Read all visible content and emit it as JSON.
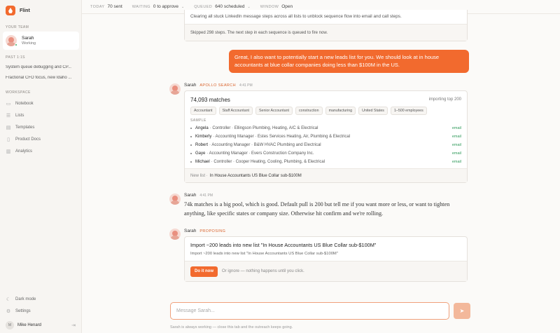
{
  "app": {
    "name": "Flint",
    "accent": "#f26a2e"
  },
  "sidebar": {
    "team_label": "YOUR TEAM",
    "team_member": {
      "name": "Sarah",
      "status": "Working"
    },
    "past_label": "PAST 1:1S",
    "past_items": [
      "System queue debugging and CP...",
      "Fractional CFO focus, new Idaho ..."
    ],
    "workspace_label": "WORKSPACE",
    "workspace_items": [
      {
        "label": "Notebook",
        "icon": "notebook-icon"
      },
      {
        "label": "Lists",
        "icon": "list-icon"
      },
      {
        "label": "Templates",
        "icon": "templates-icon"
      },
      {
        "label": "Product Docs",
        "icon": "document-icon"
      },
      {
        "label": "Analytics",
        "icon": "analytics-icon"
      }
    ],
    "bottom_items": [
      {
        "label": "Dark mode",
        "icon": "moon-icon"
      },
      {
        "label": "Settings",
        "icon": "gear-icon"
      }
    ],
    "user": {
      "initial": "M",
      "name": "Mike Henard"
    }
  },
  "topbar": {
    "today": {
      "label": "TODAY",
      "value": "70 sent"
    },
    "waiting": {
      "label": "WAITING",
      "value": "0 to approve"
    },
    "queued": {
      "label": "QUEUED",
      "value": "640 scheduled"
    },
    "window": {
      "label": "WINDOW",
      "value": "Open"
    }
  },
  "chat": {
    "top_card": {
      "text": "Clearing all stuck LinkedIn message steps across all lists to unblock sequence flow into email and call steps.",
      "footer": "Skipped 298 steps. The next step in each sequence is queued to fire now."
    },
    "user_message": "Great, I also want to potentially start a new leads list for you. We should look at in house accountants at blue collar companies doing less than $100M in the US.",
    "apollo": {
      "sender": "Sarah",
      "tag": "APOLLO SEARCH",
      "time": "4:41 PM",
      "matches": "74,093 matches",
      "importing": "importing top 200",
      "chips": [
        "Accountant",
        "Staff Accountant",
        "Senior Accountant",
        "construction",
        "manufacturing",
        "United States",
        "1–500 employees"
      ],
      "sample_label": "SAMPLE",
      "samples": [
        {
          "name": "Angela",
          "detail": "· Controller · Ellingson Plumbing, Heating, A/C & Electrical",
          "channel": "email"
        },
        {
          "name": "Kimberly",
          "detail": "· Accounting Manager · Estes Services Heating, Air, Plumbing & Electrical",
          "channel": "email"
        },
        {
          "name": "Robert",
          "detail": "· Accounting Manager · B&W HVAC Plumbing and Electrical",
          "channel": "email"
        },
        {
          "name": "Gaye",
          "detail": "· Accounting Manager · Evers Construction Company Inc.",
          "channel": "email"
        },
        {
          "name": "Michael",
          "detail": "· Controller · Cooper Heating, Cooling, Plumbing, & Electrical",
          "channel": "email"
        }
      ],
      "footer_label": "New list ·",
      "footer_value": "In House Accountants US Blue Collar sub-$100M"
    },
    "reply": {
      "sender": "Sarah",
      "time": "4:41 PM",
      "text": "74k matches is a big pool, which is good. Default pull is 200 but tell me if you want more or less, or want to tighten anything, like specific states or company size. Otherwise hit confirm and we're rolling."
    },
    "proposal": {
      "sender": "Sarah",
      "tag": "PROPOSING",
      "title": "Import ~200 leads into new list \"In House Accountants US Blue Collar sub-$100M\"",
      "subtitle": "Import ~200 leads into new list \"In House Accountants US Blue Collar sub-$100M\"",
      "confirm_label": "Do it now",
      "ignore_text": "Or ignore — nothing happens until you click."
    }
  },
  "composer": {
    "placeholder": "Message Sarah...",
    "note": "Sarah is always working — close this tab and the outreach keeps going."
  }
}
